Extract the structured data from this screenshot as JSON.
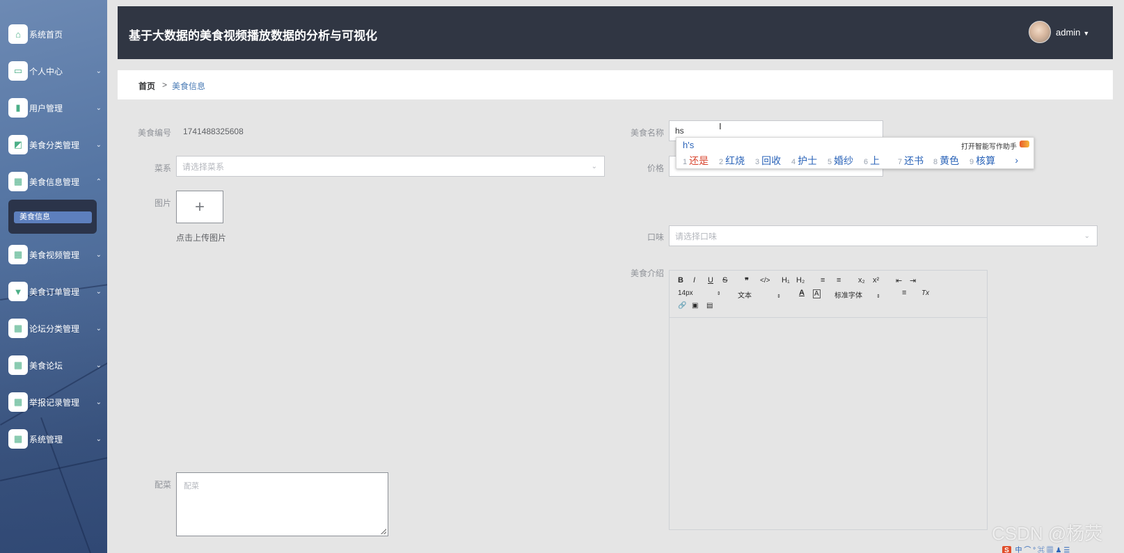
{
  "app": {
    "title": "基于大数据的美食视频播放数据的分析与可视化",
    "user": "admin"
  },
  "sidebar": {
    "items": [
      {
        "label": "系统首页",
        "icon": "home-icon",
        "arrow": ""
      },
      {
        "label": "个人中心",
        "icon": "card-icon",
        "arrow": "⌄"
      },
      {
        "label": "用户管理",
        "icon": "bar-chart-icon",
        "arrow": "⌄"
      },
      {
        "label": "美食分类管理",
        "icon": "chart-icon",
        "arrow": "⌄"
      },
      {
        "label": "美食信息管理",
        "icon": "grid-icon",
        "arrow": "⌃"
      },
      {
        "label": "美食视频管理",
        "icon": "grid-icon",
        "arrow": "⌄"
      },
      {
        "label": "美食订单管理",
        "icon": "order-icon",
        "arrow": "⌄"
      },
      {
        "label": "论坛分类管理",
        "icon": "grid-icon",
        "arrow": "⌄"
      },
      {
        "label": "美食论坛",
        "icon": "grid-icon",
        "arrow": "⌄"
      },
      {
        "label": "举报记录管理",
        "icon": "grid-icon",
        "arrow": "⌄"
      },
      {
        "label": "系统管理",
        "icon": "grid-icon",
        "arrow": "⌄"
      }
    ],
    "submenu_active": "美食信息"
  },
  "breadcrumb": {
    "home": "首页",
    "sep": ">",
    "current": "美食信息"
  },
  "form": {
    "code_label": "美食编号",
    "code_value": "1741488325608",
    "name_label": "美食名称",
    "name_value": "hs",
    "cuisine_label": "菜系",
    "cuisine_placeholder": "请选择菜系",
    "price_label": "价格",
    "image_label": "图片",
    "upload_plus": "+",
    "upload_hint": "点击上传图片",
    "taste_label": "口味",
    "taste_placeholder": "请选择口味",
    "intro_label": "美食介绍",
    "side_label": "配菜",
    "side_placeholder": "配菜"
  },
  "editor": {
    "tools_row1": [
      "B",
      "I",
      "U",
      "S",
      "❞",
      "</>",
      "H₁",
      "H₂",
      "≡",
      "≡",
      "x₂",
      "x²",
      "⇤",
      "⇥"
    ],
    "font_size": "14px",
    "text_style": "文本",
    "font_family": "标准字体",
    "tools_row2": [
      "A",
      "A",
      "≡",
      "Tx"
    ],
    "tools_row3": [
      "🔗",
      "▣",
      "▤"
    ]
  },
  "ime": {
    "composition": "h's",
    "assist": "打开智能写作助手",
    "candidates": [
      {
        "n": "1",
        "t": "还是"
      },
      {
        "n": "2",
        "t": "红烧"
      },
      {
        "n": "3",
        "t": "回收"
      },
      {
        "n": "4",
        "t": "护士"
      },
      {
        "n": "5",
        "t": "婚纱"
      },
      {
        "n": "6",
        "t": "上"
      },
      {
        "n": "7",
        "t": "还书"
      },
      {
        "n": "8",
        "t": "黄色"
      },
      {
        "n": "9",
        "t": "核算"
      }
    ],
    "more": "›"
  },
  "watermark": "CSDN @杨荧",
  "tray": "S 中 ⌒ ° ⌘ ▦ ♟ ☰"
}
